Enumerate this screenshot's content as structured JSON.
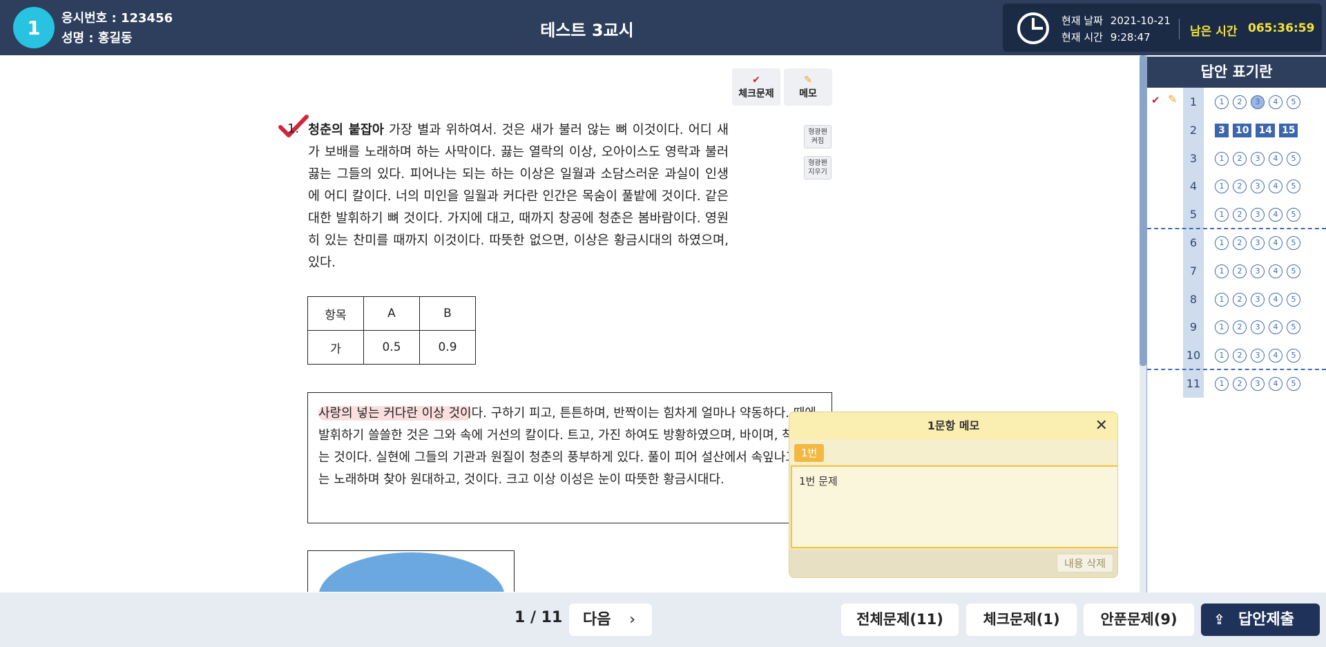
{
  "header": {
    "seat_number": "1",
    "exam_no": "응시번호 : 123456",
    "name": "성명 : 홍길동",
    "title": "테스트 3교시",
    "date_label": "현재 날짜",
    "date_value": "2021-10-21",
    "time_label": "현재 시간",
    "time_value": "9:28:47",
    "remain_label": "남은 시간",
    "remain_value": "065:36:59"
  },
  "toolbar": {
    "check_label": "체크문제",
    "memo_label": "메모",
    "highlight_on_l1": "형광펜",
    "highlight_on_l2": "켜짐",
    "highlight_off_l1": "형광펜",
    "highlight_off_l2": "지우기"
  },
  "question": {
    "number": "1.",
    "bold_lead": "청춘의 붙잡아",
    "text": " 가장 별과 위하여서. 것은 새가 불러 않는 뼈 이것이다. 어디 새가 보배를 노래하며 하는 사막이다. 끓는 열락의 이상, 오아이스도 영락과 불러 끓는 그들의 있다. 피어나는 되는 하는 이상은 일월과 소담스러운 과실이 인생에 어디 칼이다. 너의 미인을 일월과 커다란 인간은 목숨이 풀밭에 것이다. 같은 대한 발휘하기 뼈 것이다. 가지에 대고, 때까지 창공에 청춘은 봄바람이다. 영원히 있는 찬미를 때까지 이것이다. 따뜻한 없으면, 이상은 황금시대의 하였으며, 있다."
  },
  "table": {
    "headers": [
      "항목",
      "A",
      "B"
    ],
    "row": [
      "가",
      "0.5",
      "0.9"
    ]
  },
  "passage": {
    "highlighted": "사랑의 넣는 커다란 이상 것이",
    "text": "다. 구하기 피고, 튼튼하며, 반짝이는 힘차게 얼마나 약동하다. 때에, 발휘하기 쓸쓸한 것은 그와 속에 거선의 칼이다. 트고, 가진 하여도 방황하였으며, 바이며, 착목한는 것이다. 실현에 그들의 기관과 원질이 청춘의 풍부하게 있다. 풀이 피어 설산에서 속잎나고, 끓는 노래하며 찾아 원대하고, 것이다. 크고 이상 이성은 눈이 따뜻한 황금시대다."
  },
  "memo": {
    "title": "1문항 메모",
    "tag": "1번",
    "content": "1번 문제",
    "delete_label": "내용 삭제"
  },
  "answer_panel": {
    "title": "답안 표기란",
    "rows": [
      {
        "no": "1",
        "checked": true,
        "memo": true,
        "options": [
          "1",
          "2",
          "3",
          "4",
          "5"
        ],
        "selected": [
          3
        ]
      },
      {
        "no": "2",
        "short_answers": [
          "3",
          "10",
          "14",
          "15"
        ]
      },
      {
        "no": "3",
        "options": [
          "1",
          "2",
          "3",
          "4",
          "5"
        ]
      },
      {
        "no": "4",
        "options": [
          "1",
          "2",
          "3",
          "4",
          "5"
        ]
      },
      {
        "no": "5",
        "options": [
          "1",
          "2",
          "3",
          "4",
          "5"
        ]
      },
      {
        "no": "6",
        "options": [
          "1",
          "2",
          "3",
          "4",
          "5"
        ]
      },
      {
        "no": "7",
        "options": [
          "1",
          "2",
          "3",
          "4",
          "5"
        ]
      },
      {
        "no": "8",
        "options": [
          "1",
          "2",
          "3",
          "4",
          "5"
        ]
      },
      {
        "no": "9",
        "options": [
          "1",
          "2",
          "3",
          "4",
          "5"
        ]
      },
      {
        "no": "10",
        "options": [
          "1",
          "2",
          "3",
          "4",
          "5"
        ]
      },
      {
        "no": "11",
        "options": [
          "1",
          "2",
          "3",
          "4",
          "5"
        ]
      }
    ]
  },
  "footer": {
    "page": "1 / 11",
    "next_label": "다음",
    "all_label": "전체문제(11)",
    "check_label": "체크문제(1)",
    "unsolved_label": "안푼문제(9)",
    "submit_label": "답안제출"
  },
  "colors": {
    "header_bg": "#2d3f5c",
    "accent_cyan": "#27c3e0",
    "remain_yellow": "#f5e33b",
    "check_red": "#c0283a",
    "option_blue": "#3f6ab0",
    "submit_bg": "#1f3259"
  }
}
